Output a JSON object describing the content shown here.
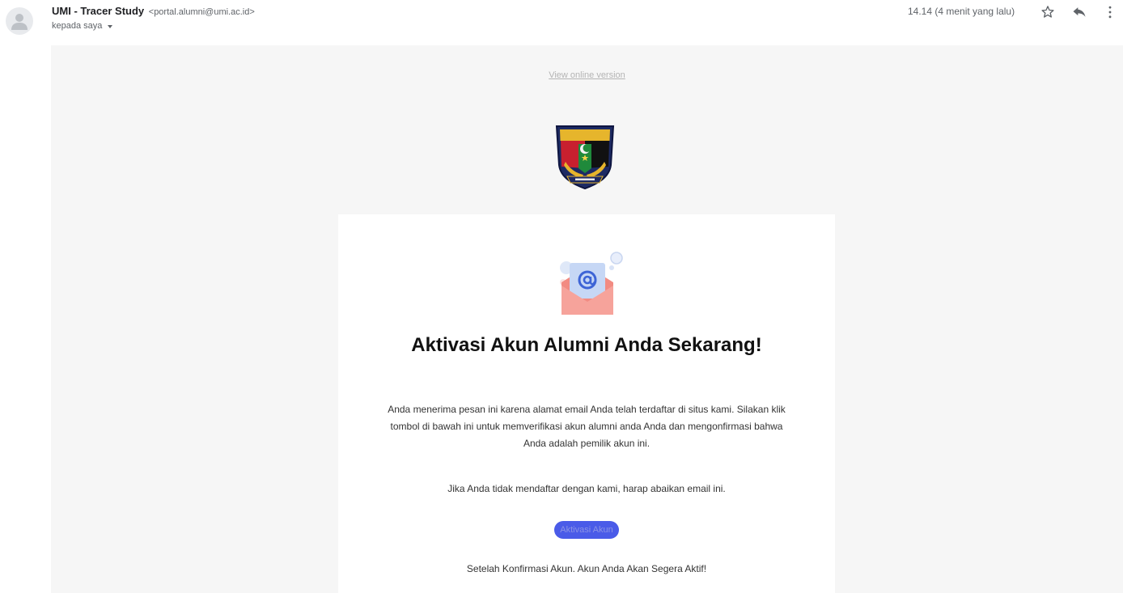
{
  "header": {
    "sender_name": "UMI - Tracer Study",
    "sender_email": "<portal.alumni@umi.ac.id>",
    "to_label": "kepada saya",
    "time": "14.14 (4 menit yang lalu)",
    "icons": [
      "person-icon",
      "star-icon",
      "reply-icon",
      "more-vert-icon",
      "chevron-down-icon"
    ]
  },
  "email": {
    "view_online": "View online version",
    "logo_icon": "umi-crest-logo",
    "illustration_icon": "envelope-at-icon",
    "headline": "Aktivasi Akun Alumni Anda Sekarang!",
    "body": "Anda menerima pesan ini karena alamat email Anda telah terdaftar di situs kami. Silakan klik tombol di bawah ini untuk memverifikasi akun alumni anda Anda dan mengonfirmasi bahwa Anda adalah pemilik akun ini.",
    "ignore_note": "Jika Anda tidak mendaftar dengan kami, harap abaikan email ini.",
    "cta_label": "Aktivasi Akun",
    "after_note": "Setelah Konfirmasi Akun. Akun Anda Akan Segera Aktif!"
  },
  "colors": {
    "background": "#f6f6f6",
    "card": "#ffffff",
    "cta": "#4a5be8",
    "envelope": "#f28b82",
    "letter": "#c6d7f5"
  }
}
